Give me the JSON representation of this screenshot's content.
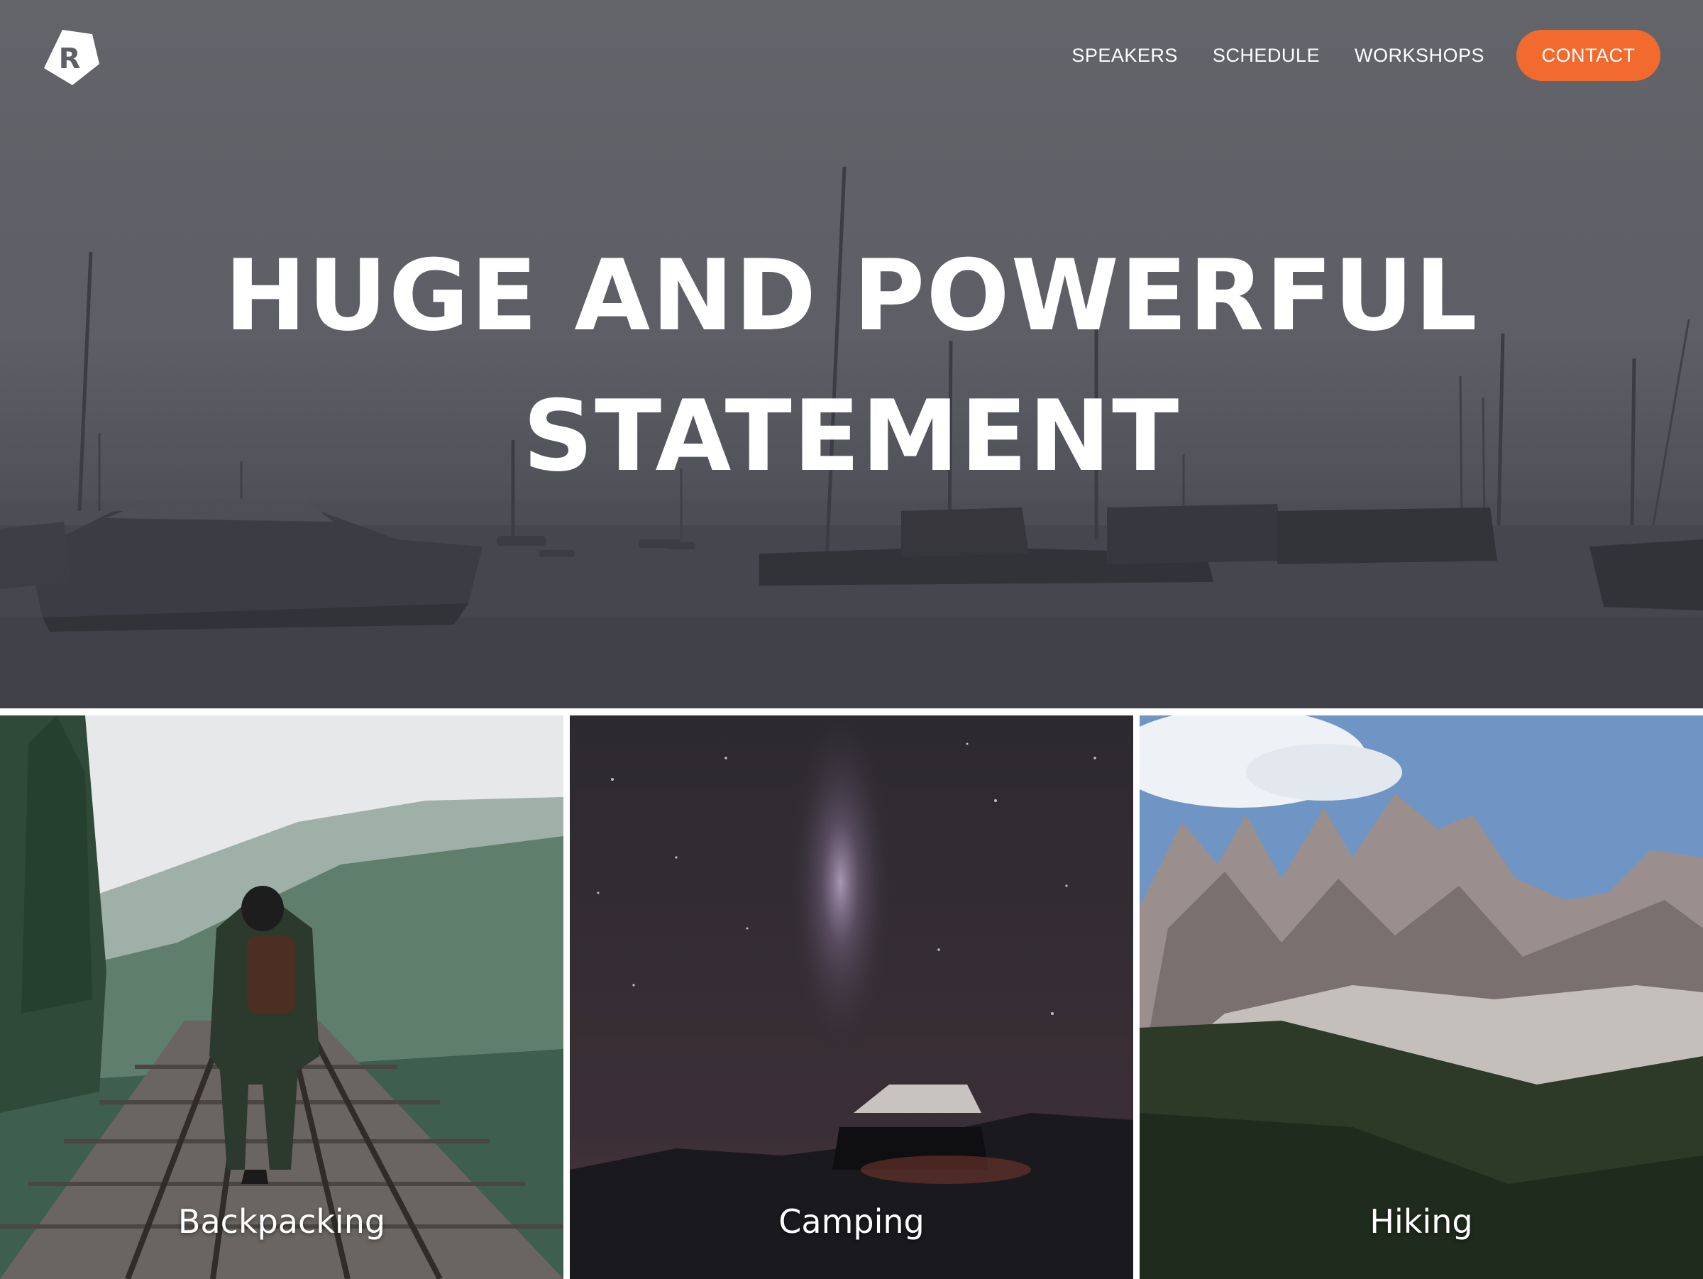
{
  "header": {
    "logo_letter": "R",
    "nav": {
      "speakers": "SPEAKERS",
      "schedule": "SCHEDULE",
      "workshops": "WORKSHOPS",
      "contact": "CONTACT"
    },
    "accent_color": "#f26a2e"
  },
  "hero": {
    "headline_line1": "HUGE AND POWERFUL",
    "headline_line2": "STATEMENT",
    "background": "marina with docked boats"
  },
  "cards": [
    {
      "label": "Backpacking",
      "image": "hiker on railway bridge with forest"
    },
    {
      "label": "Camping",
      "image": "milky way over rooftop tent on vehicle"
    },
    {
      "label": "Hiking",
      "image": "rocky mountain peaks with forested slopes"
    }
  ]
}
